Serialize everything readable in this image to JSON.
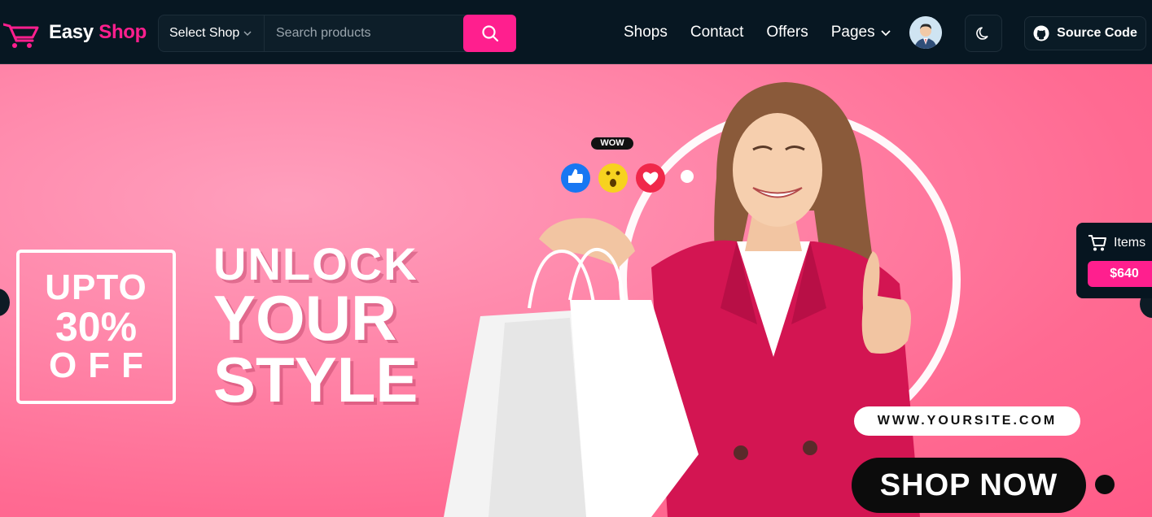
{
  "header": {
    "logo_part1": "Easy",
    "logo_part2": "Shop",
    "select_shop_label": "Select Shop",
    "search_placeholder": "Search products",
    "nav": [
      {
        "label": "Shops"
      },
      {
        "label": "Contact"
      },
      {
        "label": "Offers"
      },
      {
        "label": "Pages"
      }
    ],
    "source_code_label": "Source Code"
  },
  "hero": {
    "promo_line1": "UPTO",
    "promo_line2": "30%",
    "promo_line3": "OFF",
    "headline_line1": "UNLOCK",
    "headline_line2": "YOUR",
    "headline_line3": "STYLE",
    "wow_label": "WOW",
    "website": "WWW.YOURSITE.COM",
    "cta": "SHOP NOW"
  },
  "cart": {
    "items_label": "Items",
    "total": "$640"
  },
  "colors": {
    "navbar_bg": "#071722",
    "accent": "#ff1f8e",
    "hero_bg": "#ff7aa0",
    "blazer": "#d31552"
  },
  "icons": [
    "cart-logo-icon",
    "chevron-down-icon",
    "search-icon",
    "moon-icon",
    "github-icon",
    "shopping-cart-icon",
    "like-icon",
    "wow-icon",
    "heart-icon"
  ]
}
